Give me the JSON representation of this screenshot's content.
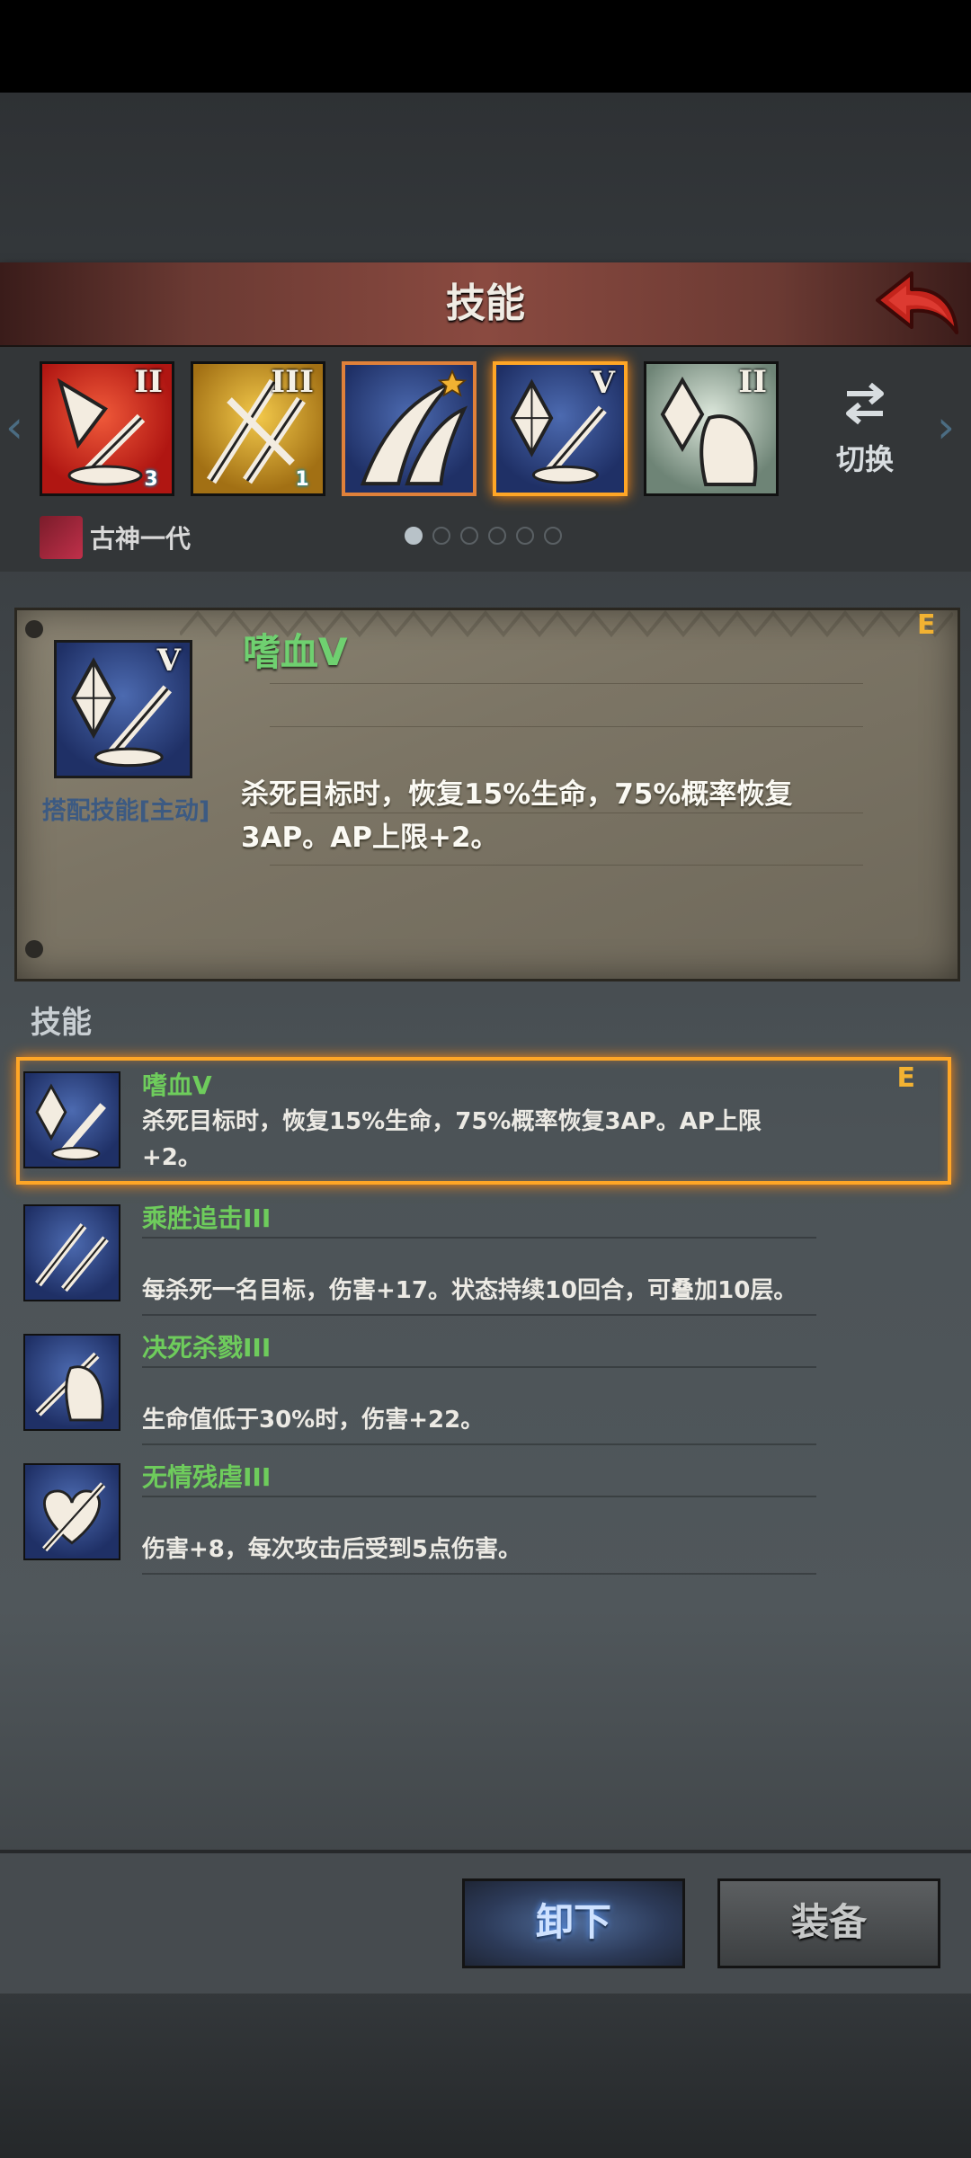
{
  "header": {
    "title": "技能"
  },
  "skill_tiles": [
    {
      "rank": "II",
      "gem_count": "3",
      "bg": "#c0201a"
    },
    {
      "rank": "III",
      "gem_count": "1",
      "bg": "#c99a1e"
    },
    {
      "rank": "",
      "gem_count": "",
      "bg": "#2f4a86"
    },
    {
      "rank": "V",
      "gem_count": "",
      "bg": "#2f4a86"
    },
    {
      "rank": "II",
      "gem_count": "",
      "bg": "#8ea294"
    }
  ],
  "switch": {
    "label": "切换"
  },
  "hero": {
    "name": "古神一代"
  },
  "pager": {
    "total": 6,
    "active": 0
  },
  "detail": {
    "title": "嗜血V",
    "rank": "V",
    "grade": "E",
    "caption": "搭配技能[主动]",
    "description": "杀死目标时，恢复15%生命，75%概率恢复3AP。AP上限+2。"
  },
  "list": {
    "heading": "技能",
    "items": [
      {
        "title": "嗜血V",
        "grade": "E",
        "description": "杀死目标时，恢复15%生命，75%概率恢复3AP。AP上限+2。"
      },
      {
        "title": "乘胜追击III",
        "grade": "",
        "description": "每杀死一名目标，伤害+17。状态持续10回合，可叠加10层。"
      },
      {
        "title": "决死杀戮III",
        "grade": "",
        "description": "生命值低于30%时，伤害+22。"
      },
      {
        "title": "无情残虐III",
        "grade": "",
        "description": "伤害+8，每次攻击后受到5点伤害。"
      }
    ]
  },
  "buttons": {
    "unload": "卸下",
    "equip": "装备"
  },
  "colors": {
    "accent_orange": "#ffa626",
    "skill_green": "#6ecc5c",
    "grade_gold": "#f2b232"
  }
}
